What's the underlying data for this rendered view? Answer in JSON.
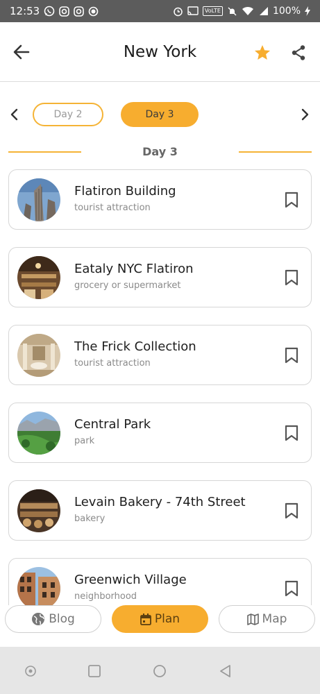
{
  "status_bar": {
    "time": "12:53",
    "volte": "VoLTE",
    "battery": "100%"
  },
  "header": {
    "title": "New York",
    "accent_color": "#f7ad2f"
  },
  "day_selector": {
    "previous_day": "Day 2",
    "current_day": "Day 3",
    "heading": "Day 3"
  },
  "places": [
    {
      "name": "Flatiron Building",
      "type": "tourist attraction",
      "thumb": "skyscraper-photo"
    },
    {
      "name": "Eataly NYC Flatiron",
      "type": "grocery or supermarket",
      "thumb": "market-interior-photo"
    },
    {
      "name": "The Frick Collection",
      "type": "tourist attraction",
      "thumb": "museum-courtyard-photo"
    },
    {
      "name": "Central Park",
      "type": "park",
      "thumb": "park-landscape-photo"
    },
    {
      "name": "Levain Bakery - 74th Street",
      "type": "bakery",
      "thumb": "bakery-shelves-photo"
    },
    {
      "name": "Greenwich Village",
      "type": "neighborhood",
      "thumb": "street-buildings-photo"
    }
  ],
  "tabs": {
    "blog": "Blog",
    "plan": "Plan",
    "map": "Map"
  }
}
